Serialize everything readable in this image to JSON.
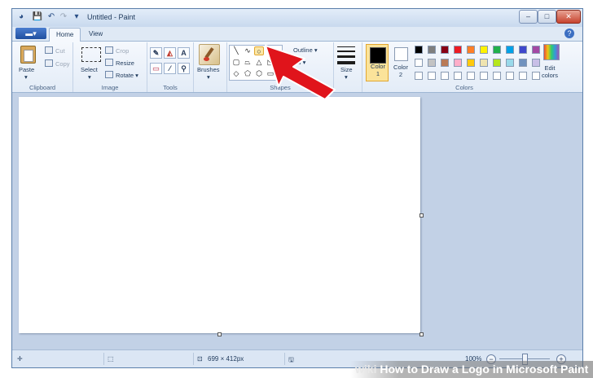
{
  "app": {
    "title": "Untitled - Paint"
  },
  "window_controls": {
    "minimize": "–",
    "maximize": "□",
    "close": "✕"
  },
  "quick_access": {
    "save": "💾",
    "undo": "↶",
    "redo": "↷"
  },
  "tabs": {
    "menu": "▬▾",
    "home": "Home",
    "view": "View"
  },
  "clipboard": {
    "paste": "Paste",
    "cut": "Cut",
    "copy": "Copy",
    "label": "Clipboard"
  },
  "image": {
    "select": "Select",
    "crop": "Crop",
    "resize": "Resize",
    "rotate": "Rotate ▾",
    "label": "Image"
  },
  "tools": {
    "label": "Tools",
    "text": "A"
  },
  "brushes": {
    "label": "Brushes"
  },
  "shapes": {
    "outline": "Outline ▾",
    "fill": "Fill ▾",
    "label": "Shapes"
  },
  "size": {
    "label": "Size"
  },
  "colors": {
    "color1": "Color\n1",
    "color1_line1": "Color",
    "color1_line2": "1",
    "color2_line1": "Color",
    "color2_line2": "2",
    "edit": "Edit\ncolors",
    "edit_line1": "Edit",
    "edit_line2": "colors",
    "label": "Colors",
    "palette_row1": [
      "#000000",
      "#7f7f7f",
      "#880015",
      "#ed1c24",
      "#ff7f27",
      "#fff200",
      "#22b14c",
      "#00a2e8",
      "#3f48cc",
      "#a349a4"
    ],
    "palette_row2": [
      "#ffffff",
      "#c3c3c3",
      "#b97a57",
      "#ffaec9",
      "#ffc90e",
      "#efe4b0",
      "#b5e61d",
      "#99d9ea",
      "#7092be",
      "#c8bfe7"
    ]
  },
  "status": {
    "canvas_size": "699 × 412px",
    "zoom": "100%"
  },
  "watermark": {
    "brand": "wiki",
    "text": "How to Draw a Logo in Microsoft Paint"
  },
  "accent": {
    "arrow": "#e0141b",
    "ribbon_blue": "#1f4f9f"
  }
}
